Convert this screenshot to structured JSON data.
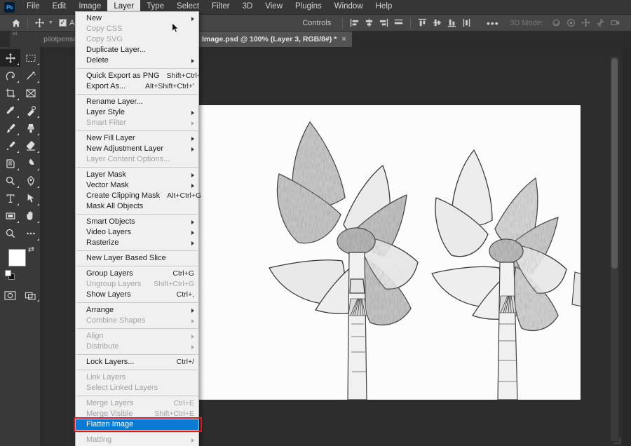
{
  "app": {
    "logo_text": "Ps",
    "accent_highlight": "#0a7ad4",
    "annotation_color": "#e8121b"
  },
  "menubar": {
    "items": [
      {
        "label": "File",
        "active": false
      },
      {
        "label": "Edit",
        "active": false
      },
      {
        "label": "Image",
        "active": false
      },
      {
        "label": "Layer",
        "active": true
      },
      {
        "label": "Type",
        "active": false
      },
      {
        "label": "Select",
        "active": false
      },
      {
        "label": "Filter",
        "active": false
      },
      {
        "label": "3D",
        "active": false
      },
      {
        "label": "View",
        "active": false
      },
      {
        "label": "Plugins",
        "active": false
      },
      {
        "label": "Window",
        "active": false
      },
      {
        "label": "Help",
        "active": false
      }
    ]
  },
  "options_bar": {
    "home_icon": "home-icon",
    "tool_icon": "move-tool-icon",
    "auto_select_label": "Au",
    "auto_select_checked": true,
    "controls_label": "Controls",
    "more_label": "•••",
    "three_d_mode_label": "3D Mode:",
    "align_icons": [
      "align-left-edges-icon",
      "align-horizontal-centers-icon",
      "align-right-edges-icon",
      "align-top-edges-icon"
    ],
    "distribute_icons": [
      "distribute-top-edges-icon",
      "distribute-vertical-centers-icon",
      "distribute-bottom-edges-icon",
      "distribute-horizontal-centers-icon"
    ],
    "three_d_icons": [
      "3d-orbit-icon",
      "3d-roll-icon",
      "3d-pan-icon",
      "3d-slide-icon",
      "3d-camera-icon"
    ]
  },
  "tabs": [
    {
      "label": "pilotpenso",
      "active": false,
      "badge": "64",
      "closable": false
    },
    {
      "label": "Image.psd @ 100% (Layer 3, RGB/8#) *",
      "active": true,
      "close": "×",
      "closable": true
    }
  ],
  "toolbar": {
    "tools": [
      {
        "name": "move-tool",
        "selected": true,
        "has_flyout": true
      },
      {
        "name": "rectangular-marquee-tool",
        "selected": false,
        "has_flyout": true
      },
      {
        "name": "lasso-tool",
        "selected": false,
        "has_flyout": true
      },
      {
        "name": "magic-wand-tool",
        "selected": false,
        "has_flyout": true
      },
      {
        "name": "crop-tool",
        "selected": false,
        "has_flyout": true
      },
      {
        "name": "frame-tool",
        "selected": false,
        "has_flyout": false
      },
      {
        "name": "eyedropper-tool",
        "selected": false,
        "has_flyout": true
      },
      {
        "name": "spot-healing-brush-tool",
        "selected": false,
        "has_flyout": true
      },
      {
        "name": "brush-tool",
        "selected": false,
        "has_flyout": true
      },
      {
        "name": "clone-stamp-tool",
        "selected": false,
        "has_flyout": true
      },
      {
        "name": "history-brush-tool",
        "selected": false,
        "has_flyout": true
      },
      {
        "name": "eraser-tool",
        "selected": false,
        "has_flyout": true
      },
      {
        "name": "gradient-tool",
        "selected": false,
        "has_flyout": true
      },
      {
        "name": "blur-tool",
        "selected": false,
        "has_flyout": true
      },
      {
        "name": "dodge-tool",
        "selected": false,
        "has_flyout": true
      },
      {
        "name": "pen-tool",
        "selected": false,
        "has_flyout": true
      },
      {
        "name": "type-tool",
        "selected": false,
        "has_flyout": true
      },
      {
        "name": "path-selection-tool",
        "selected": false,
        "has_flyout": true
      },
      {
        "name": "rectangle-tool",
        "selected": false,
        "has_flyout": true
      },
      {
        "name": "hand-tool",
        "selected": false,
        "has_flyout": true
      },
      {
        "name": "zoom-tool",
        "selected": false,
        "has_flyout": false
      },
      {
        "name": "edit-toolbar-tool",
        "selected": false,
        "has_flyout": true
      }
    ],
    "foreground_color": "#ffffff",
    "background_color": "#111111",
    "swap_icon": "swap-colors-icon",
    "default_colors_icon": "default-colors-icon",
    "quick_mask_icon": "quick-mask-icon",
    "screen_mode_icon": "screen-mode-icon"
  },
  "layer_menu": {
    "title": "Layer",
    "groups": [
      {
        "items": [
          {
            "label": "New",
            "shortcut": "",
            "submenu": true,
            "disabled": false
          },
          {
            "label": "Copy CSS",
            "shortcut": "",
            "submenu": false,
            "disabled": true
          },
          {
            "label": "Copy SVG",
            "shortcut": "",
            "submenu": false,
            "disabled": true
          },
          {
            "label": "Duplicate Layer...",
            "shortcut": "",
            "submenu": false,
            "disabled": false
          },
          {
            "label": "Delete",
            "shortcut": "",
            "submenu": true,
            "disabled": false
          }
        ]
      },
      {
        "items": [
          {
            "label": "Quick Export as PNG",
            "shortcut": "Shift+Ctrl+'",
            "submenu": false,
            "disabled": false
          },
          {
            "label": "Export As...",
            "shortcut": "Alt+Shift+Ctrl+'",
            "submenu": false,
            "disabled": false
          }
        ]
      },
      {
        "items": [
          {
            "label": "Rename Layer...",
            "shortcut": "",
            "submenu": false,
            "disabled": false
          },
          {
            "label": "Layer Style",
            "shortcut": "",
            "submenu": true,
            "disabled": false
          },
          {
            "label": "Smart Filter",
            "shortcut": "",
            "submenu": true,
            "disabled": true
          }
        ]
      },
      {
        "items": [
          {
            "label": "New Fill Layer",
            "shortcut": "",
            "submenu": true,
            "disabled": false
          },
          {
            "label": "New Adjustment Layer",
            "shortcut": "",
            "submenu": true,
            "disabled": false
          },
          {
            "label": "Layer Content Options...",
            "shortcut": "",
            "submenu": false,
            "disabled": true
          }
        ]
      },
      {
        "items": [
          {
            "label": "Layer Mask",
            "shortcut": "",
            "submenu": true,
            "disabled": false
          },
          {
            "label": "Vector Mask",
            "shortcut": "",
            "submenu": true,
            "disabled": false
          },
          {
            "label": "Create Clipping Mask",
            "shortcut": "Alt+Ctrl+G",
            "submenu": false,
            "disabled": false
          },
          {
            "label": "Mask All Objects",
            "shortcut": "",
            "submenu": false,
            "disabled": false
          }
        ]
      },
      {
        "items": [
          {
            "label": "Smart Objects",
            "shortcut": "",
            "submenu": true,
            "disabled": false
          },
          {
            "label": "Video Layers",
            "shortcut": "",
            "submenu": true,
            "disabled": false
          },
          {
            "label": "Rasterize",
            "shortcut": "",
            "submenu": true,
            "disabled": false
          }
        ]
      },
      {
        "items": [
          {
            "label": "New Layer Based Slice",
            "shortcut": "",
            "submenu": false,
            "disabled": false
          }
        ]
      },
      {
        "items": [
          {
            "label": "Group Layers",
            "shortcut": "Ctrl+G",
            "submenu": false,
            "disabled": false
          },
          {
            "label": "Ungroup Layers",
            "shortcut": "Shift+Ctrl+G",
            "submenu": false,
            "disabled": true
          },
          {
            "label": "Show Layers",
            "shortcut": "Ctrl+,",
            "submenu": false,
            "disabled": false
          }
        ]
      },
      {
        "items": [
          {
            "label": "Arrange",
            "shortcut": "",
            "submenu": true,
            "disabled": false
          },
          {
            "label": "Combine Shapes",
            "shortcut": "",
            "submenu": true,
            "disabled": true
          }
        ]
      },
      {
        "items": [
          {
            "label": "Align",
            "shortcut": "",
            "submenu": true,
            "disabled": true
          },
          {
            "label": "Distribute",
            "shortcut": "",
            "submenu": true,
            "disabled": true
          }
        ]
      },
      {
        "items": [
          {
            "label": "Lock Layers...",
            "shortcut": "Ctrl+/",
            "submenu": false,
            "disabled": false
          }
        ]
      },
      {
        "items": [
          {
            "label": "Link Layers",
            "shortcut": "",
            "submenu": false,
            "disabled": true
          },
          {
            "label": "Select Linked Layers",
            "shortcut": "",
            "submenu": false,
            "disabled": true
          }
        ]
      },
      {
        "items": [
          {
            "label": "Merge Layers",
            "shortcut": "Ctrl+E",
            "submenu": false,
            "disabled": true
          },
          {
            "label": "Merge Visible",
            "shortcut": "Shift+Ctrl+E",
            "submenu": false,
            "disabled": true
          },
          {
            "label": "Flatten Image",
            "shortcut": "",
            "submenu": false,
            "disabled": false,
            "highlighted": true,
            "annotated": true
          }
        ]
      },
      {
        "items": [
          {
            "label": "Matting",
            "shortcut": "",
            "submenu": true,
            "disabled": true
          }
        ]
      }
    ]
  },
  "document": {
    "artwork_description": "pencil-sketch pinwheel flowers on sticks"
  }
}
